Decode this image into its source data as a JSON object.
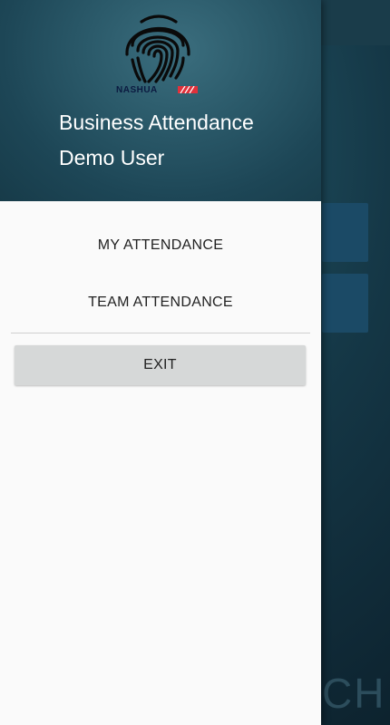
{
  "drawer": {
    "logo_text": "NASHUA",
    "title": "Business Attendance",
    "user": "Demo User",
    "menu": [
      {
        "label": "MY ATTENDANCE"
      },
      {
        "label": "TEAM ATTENDANCE"
      }
    ],
    "exit_label": "EXIT"
  },
  "background": {
    "watermark_text": "CH"
  },
  "colors": {
    "header_bg": "#2b5a6a",
    "drawer_bg": "#fafafa",
    "exit_button": "#d6d8d8",
    "logo_flag": "#e0313b",
    "logo_text": "#0b1a40"
  },
  "icons": {
    "logo": "fingerprint-logo"
  }
}
